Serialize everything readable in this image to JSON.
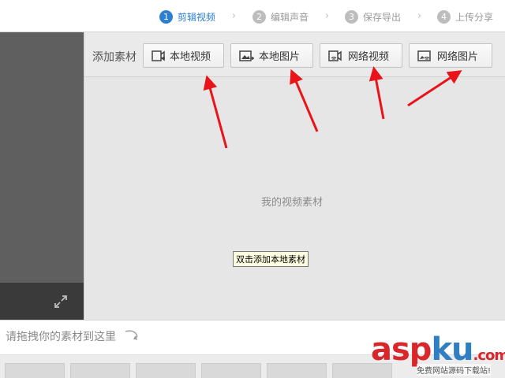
{
  "steps": [
    {
      "num": "1",
      "label": "剪辑视频"
    },
    {
      "num": "2",
      "label": "编辑声音"
    },
    {
      "num": "3",
      "label": "保存导出"
    },
    {
      "num": "4",
      "label": "上传分享"
    }
  ],
  "toolbar": {
    "add_label": "添加素材",
    "buttons": [
      "本地视频",
      "本地图片",
      "网络视频",
      "网络图片"
    ]
  },
  "main": {
    "empty_text": "我的视频素材",
    "tooltip": "双击添加本地素材"
  },
  "timeline": {
    "drop_text": "请拖拽你的素材到这里"
  },
  "watermark": {
    "asp": "asp",
    "ku": "ku",
    "com": ".com",
    "sub": "免费网站源码下载站!"
  },
  "colors": {
    "accent": "#2d7fd2",
    "arrow": "#e8141a"
  },
  "icons": [
    "expand-icon",
    "local-video-icon",
    "local-image-icon",
    "network-video-icon",
    "network-image-icon"
  ]
}
